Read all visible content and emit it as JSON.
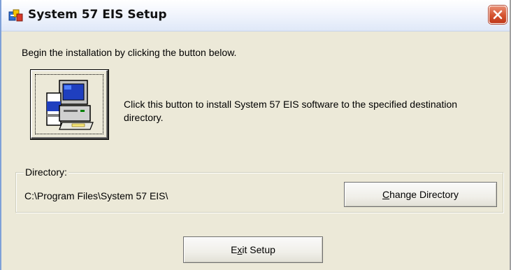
{
  "window": {
    "title": "System 57 EIS Setup",
    "icon": "setup-icon"
  },
  "titlebar": {
    "close_icon": "close-icon"
  },
  "main": {
    "intro_text": "Begin the installation by clicking the button below.",
    "install_button_icon": "computer-install-icon",
    "install_description_line1": "Click this button to install System 57 EIS software to the specified destination",
    "install_description_line2": "directory."
  },
  "directory": {
    "label": "Directory:",
    "path": "C:\\Program Files\\System 57 EIS\\",
    "change_button": {
      "mnemonic": "C",
      "rest": "hange Directory"
    }
  },
  "footer": {
    "exit_button": {
      "prefix": "E",
      "mnemonic": "x",
      "rest": "it Setup"
    }
  },
  "colors": {
    "dialog_bg": "#ece9d8",
    "close_button": "#d4532f",
    "titlebar_bg": "#f3f6fd"
  }
}
